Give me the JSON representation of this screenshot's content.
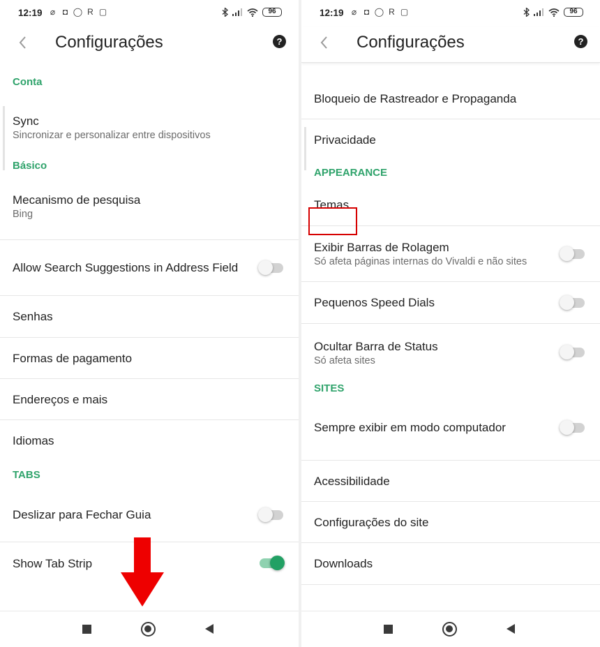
{
  "left": {
    "status": {
      "time": "12:19",
      "battery": "96"
    },
    "title": "Configurações",
    "sections": {
      "conta": "Conta",
      "basico": "Básico",
      "tabs": "TABS"
    },
    "sync": {
      "label": "Sync",
      "sub": "Sincronizar e personalizar entre dispositivos"
    },
    "search_engine": {
      "label": "Mecanismo de pesquisa",
      "sub": "Bing"
    },
    "allow_suggestions": {
      "label": "Allow Search Suggestions in Address Field",
      "enabled": false
    },
    "senhas": "Senhas",
    "pagamento": "Formas de pagamento",
    "enderecos": "Endereços e mais",
    "idiomas": "Idiomas",
    "swipe_close": {
      "label": "Deslizar para Fechar Guia",
      "enabled": false
    },
    "tab_strip": {
      "label": "Show Tab Strip",
      "enabled": true
    }
  },
  "right": {
    "status": {
      "time": "12:19",
      "battery": "96"
    },
    "title": "Configurações",
    "tracker_block": "Bloqueio de Rastreador e Propaganda",
    "privacidade": "Privacidade",
    "sections": {
      "appearance": "APPEARANCE",
      "sites": "SITES"
    },
    "temas": "Temas",
    "scrollbars": {
      "label": "Exibir Barras de Rolagem",
      "sub": "Só afeta páginas internas do Vivaldi e não sites",
      "enabled": false
    },
    "speed_dials": {
      "label": "Pequenos Speed Dials",
      "enabled": false
    },
    "status_bar": {
      "label": "Ocultar Barra de Status",
      "sub": "Só afeta sites",
      "enabled": false
    },
    "desktop_mode": {
      "label": "Sempre exibir em modo computador",
      "enabled": false
    },
    "acessibilidade": "Acessibilidade",
    "site_settings": "Configurações do site",
    "downloads": "Downloads"
  },
  "colors": {
    "accent": "#2fa36b",
    "annotation": "#d60000"
  },
  "icons": [
    "back-chevron-icon",
    "help-icon",
    "bluetooth-icon",
    "signal-icon",
    "wifi-icon",
    "battery-icon",
    "nav-recents-icon",
    "nav-home-icon",
    "nav-back-icon"
  ]
}
